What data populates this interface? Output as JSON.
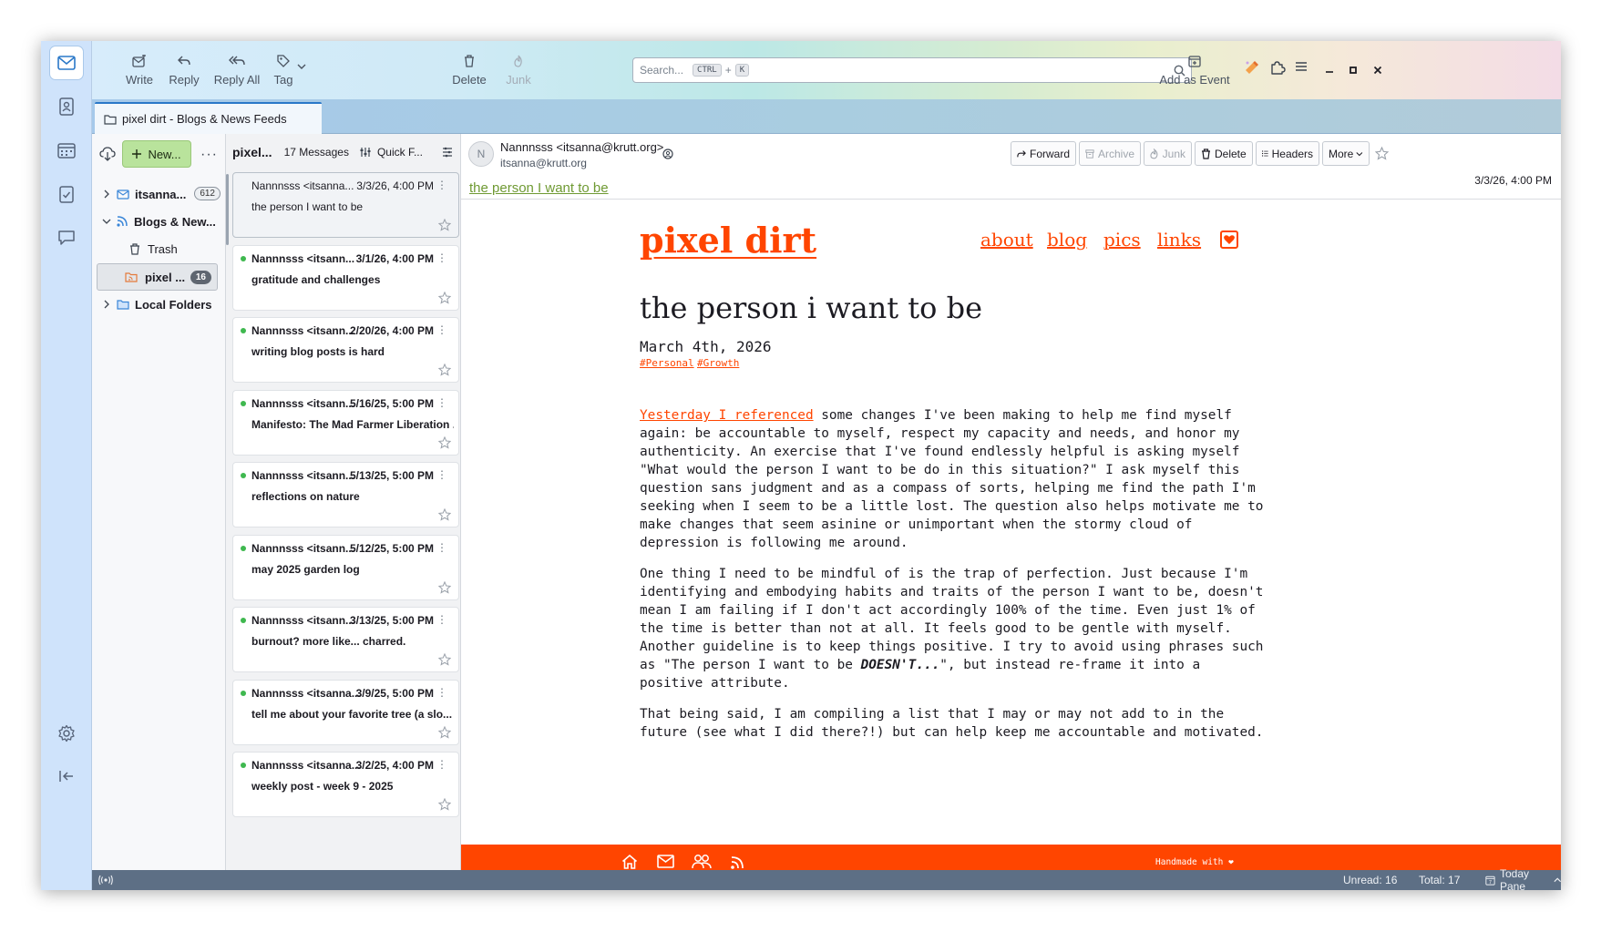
{
  "toolbar": {
    "write": "Write",
    "reply": "Reply",
    "reply_all": "Reply All",
    "tag": "Tag",
    "delete": "Delete",
    "junk": "Junk",
    "search_placeholder": "Search...",
    "search_key1": "CTRL",
    "search_plus": "+",
    "search_key2": "K",
    "add_event": "Add as Event"
  },
  "tab": {
    "label": "pixel dirt - Blogs & News Feeds"
  },
  "folders": {
    "new_label": "New...",
    "items": [
      {
        "label": "itsanna...",
        "count": "612"
      },
      {
        "label": "Blogs & New..."
      },
      {
        "label": "Trash"
      },
      {
        "label": "pixel ...",
        "count": "16"
      },
      {
        "label": "Local Folders"
      }
    ]
  },
  "thread_header": {
    "folder": "pixel...",
    "count": "17 Messages",
    "quick_filter": "Quick F..."
  },
  "messages": [
    {
      "from": "Nannnsss <itsanna...",
      "date": "3/3/26, 4:00 PM",
      "subject": "the person I want to be"
    },
    {
      "from": "Nannnsss <itsann...",
      "date": "3/1/26, 4:00 PM",
      "subject": "gratitude and challenges"
    },
    {
      "from": "Nannnsss <itsann...",
      "date": "2/20/26, 4:00 PM",
      "subject": "writing blog posts is hard"
    },
    {
      "from": "Nannnsss <itsann...",
      "date": "5/16/25, 5:00 PM",
      "subject": "Manifesto: The Mad Farmer Liberation ..."
    },
    {
      "from": "Nannnsss <itsann...",
      "date": "5/13/25, 5:00 PM",
      "subject": "reflections on nature"
    },
    {
      "from": "Nannnsss <itsann...",
      "date": "5/12/25, 5:00 PM",
      "subject": "may 2025 garden log"
    },
    {
      "from": "Nannnsss <itsann...",
      "date": "3/13/25, 5:00 PM",
      "subject": "burnout? more like... charred."
    },
    {
      "from": "Nannnsss <itsanna...",
      "date": "3/9/25, 5:00 PM",
      "subject": "tell me about your favorite tree (a slo..."
    },
    {
      "from": "Nannnsss <itsanna...",
      "date": "3/2/25, 4:00 PM",
      "subject": "weekly post - week 9 - 2025"
    }
  ],
  "header": {
    "avatar": "N",
    "from": "Nannnsss <itsanna@krutt.org>",
    "address": "itsanna@krutt.org",
    "subject": "the person I want to be",
    "date": "3/3/26, 4:00 PM",
    "forward": "Forward",
    "archive": "Archive",
    "junk": "Junk",
    "delete": "Delete",
    "headers": "Headers",
    "more": "More"
  },
  "blog": {
    "site_title": "pixel dirt",
    "nav": [
      "about",
      "blog",
      "pics",
      "links"
    ],
    "post_title": "the person i want to be",
    "post_date": "March 4th, 2026",
    "tags": [
      "#Personal",
      "#Growth"
    ],
    "p1_link": "Yesterday I referenced",
    "p1_lines": [
      " some changes I've been making to help me find myself",
      "again: be accountable to myself, respect my capacity and needs, and honor my",
      "authenticity. An exercise that I've found endlessly helpful is asking myself",
      "\"What would the person I want to be do in this situation?\" I ask myself this",
      "question sans judgment and as a compass of sorts, helping me find the path I'm",
      "seeking when I seem to be a little lost. The question also helps motivate me to",
      "make changes that seem asinine or unimportant when the stormy cloud of",
      "depression is following me around."
    ],
    "p2_lines": [
      "One thing I need to be mindful of is the trap of perfection. Just because I'm",
      "identifying and embodying habits and traits of the person I want to be, doesn't",
      "mean I am failing if I don't act accordingly 100% of the time. Even just 1% of",
      "the time is better than not at all. It feels good to be gentle with myself.",
      "Another guideline is to keep things positive. I try to avoid using phrases such"
    ],
    "p2_pre": "as \"The person I want to be ",
    "p2_emph": "DOESN'T...",
    "p2_post": "\", but instead re-frame it into a",
    "p2_last": "positive attribute.",
    "p3_lines": [
      "That being said, I am compiling a list that I may or may not add to in the",
      "future (see what I did there?!) but can help keep me accountable and motivated."
    ],
    "footer_text": "Handmade with ❤"
  },
  "status": {
    "unread": "Unread: 16",
    "total": "Total: 17",
    "today_pane": "Today Pane"
  },
  "colors": {
    "accent": "#ff4500",
    "new_button": "#b9e39c",
    "unread_dot": "#3fb84f"
  }
}
